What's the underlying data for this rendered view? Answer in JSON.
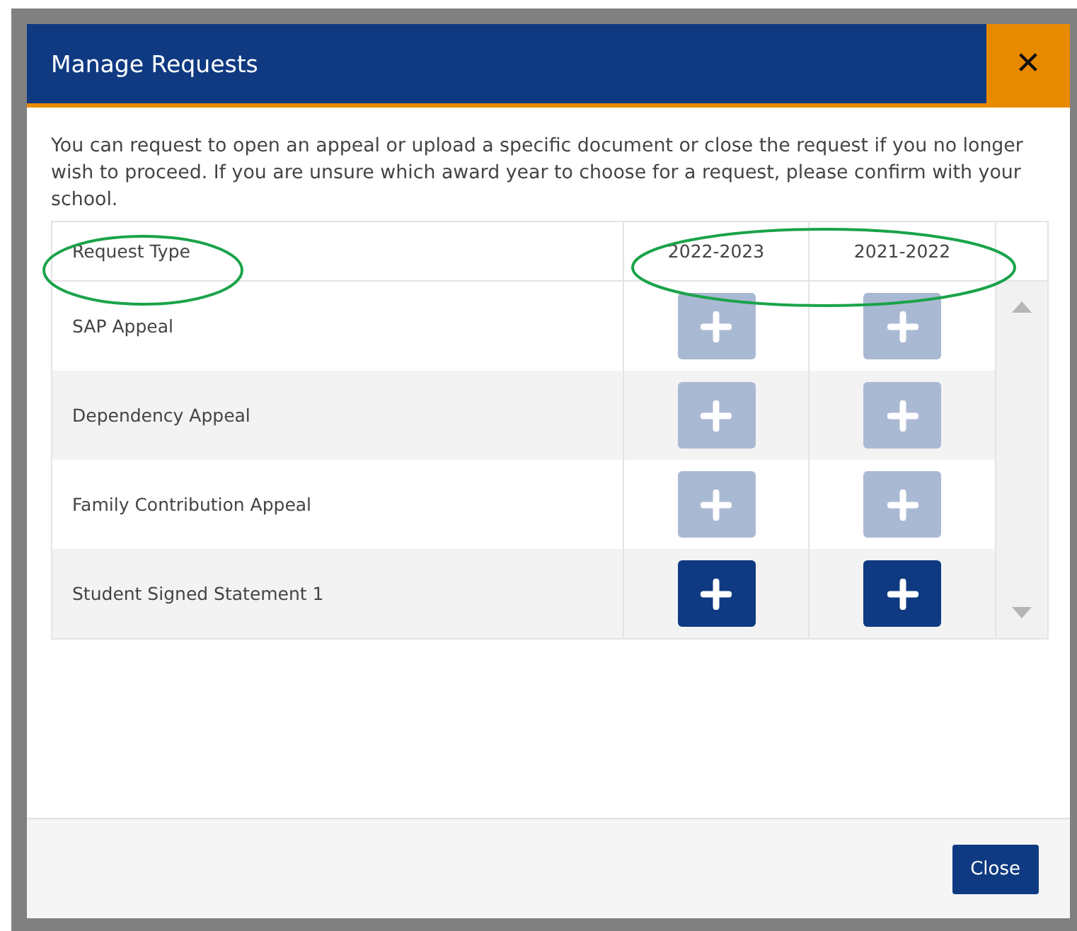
{
  "dialog": {
    "title": "Manage Requests",
    "close_icon": "✕",
    "intro": "You can request to open an appeal or upload a specific document or close the request if you no longer wish to proceed. If you are unsure which award year to choose for a request, please confirm with your school.",
    "table": {
      "columns": [
        "Request Type",
        "2022-2023",
        "2021-2022"
      ],
      "rows": [
        {
          "request_type": "SAP Appeal",
          "add_buttons": [
            {
              "disabled": true
            },
            {
              "disabled": true
            }
          ]
        },
        {
          "request_type": "Dependency Appeal",
          "add_buttons": [
            {
              "disabled": true
            },
            {
              "disabled": true
            }
          ]
        },
        {
          "request_type": "Family Contribution Appeal",
          "add_buttons": [
            {
              "disabled": true
            },
            {
              "disabled": true
            }
          ]
        },
        {
          "request_type": "Student Signed Statement 1",
          "add_buttons": [
            {
              "disabled": false
            },
            {
              "disabled": false
            }
          ]
        }
      ]
    },
    "buttons": [
      "Close"
    ]
  }
}
